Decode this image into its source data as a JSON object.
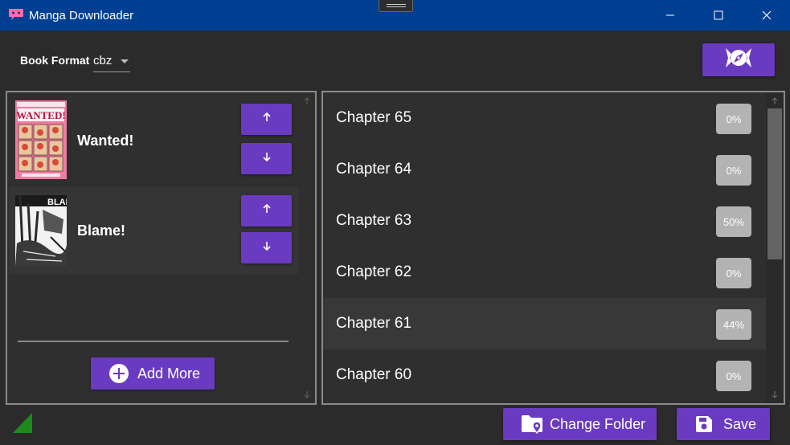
{
  "window": {
    "title": "Manga Downloader",
    "icon": "speech-bubble-icon",
    "controls": [
      "minimize-icon",
      "maximize-icon",
      "close-icon"
    ]
  },
  "toolbar": {
    "format_label": "Book Format",
    "format_value": "cbz",
    "browse_icon": "compass-icon"
  },
  "manga_list": {
    "items": [
      {
        "title": "Wanted!",
        "up_icon": "arrow-up-icon",
        "down_icon": "arrow-down-icon"
      },
      {
        "title": "Blame!",
        "up_icon": "arrow-up-icon",
        "down_icon": "arrow-down-icon"
      }
    ],
    "add_more_label": "Add More",
    "add_icon": "plus-circle-icon"
  },
  "chapters": [
    {
      "name": "Chapter 65",
      "progress": "0%"
    },
    {
      "name": "Chapter 64",
      "progress": "0%"
    },
    {
      "name": "Chapter 63",
      "progress": "50%"
    },
    {
      "name": "Chapter 62",
      "progress": "0%"
    },
    {
      "name": "Chapter 61",
      "progress": "44%"
    },
    {
      "name": "Chapter 60",
      "progress": "0%"
    }
  ],
  "footer": {
    "change_folder_label": "Change Folder",
    "change_folder_icon": "folder-location-icon",
    "save_label": "Save",
    "save_icon": "floppy-disk-icon",
    "status_icon": "signal-corner-icon"
  },
  "colors": {
    "titlebar": "#003f91",
    "background": "#2b2b2b",
    "accent": "#6a3bc0",
    "badge": "#b3b3b3",
    "status_indicator": "#1d8a1d"
  }
}
